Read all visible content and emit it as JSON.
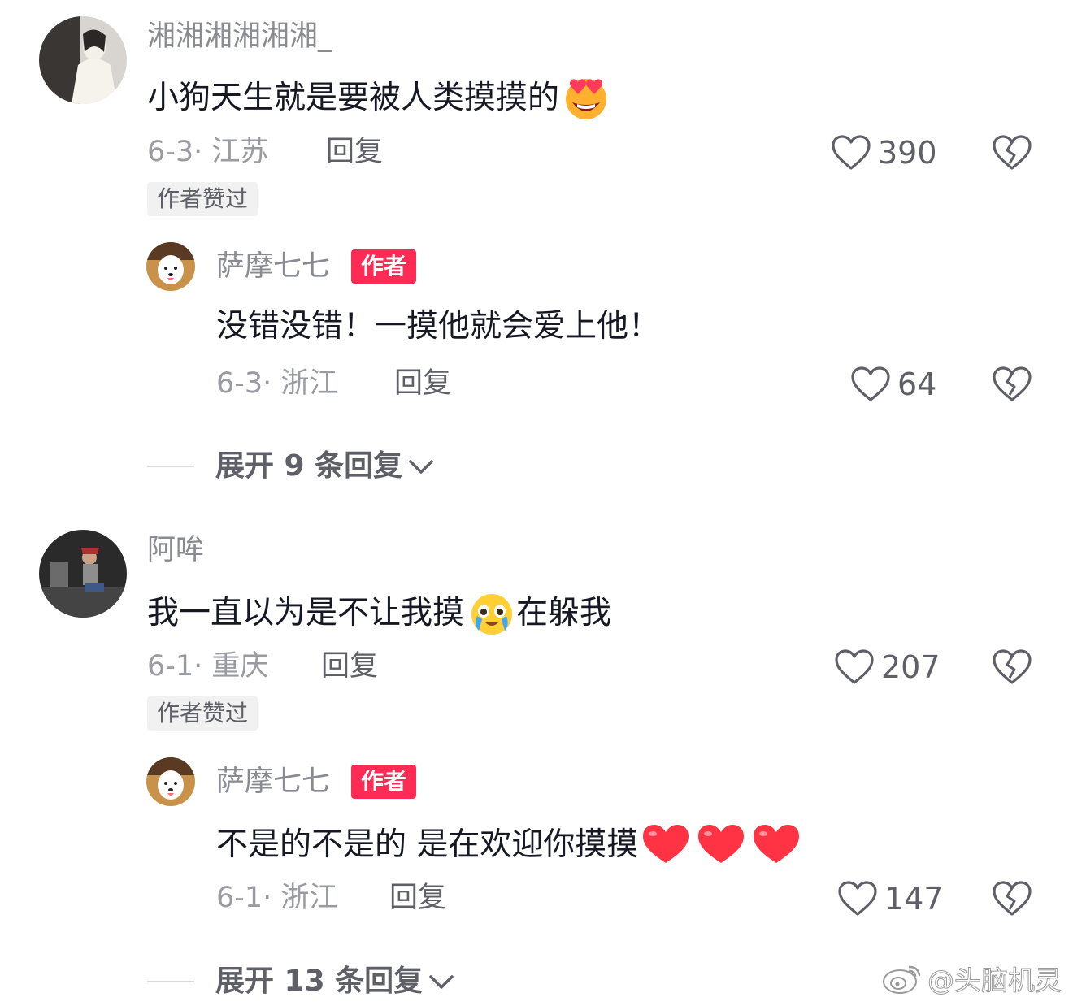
{
  "comments": [
    {
      "username": "湘湘湘湘湘湘_",
      "text": "小狗天生就是要被人类摸摸的",
      "date_location": "6-3· 江苏",
      "reply_label": "回复",
      "likes": "390",
      "badge": "作者赞过",
      "emoji": "heart-eyes-emoji",
      "replies": [
        {
          "username": "萨摩七七",
          "tag": "作者",
          "text": "没错没错！一摸他就会爱上他！",
          "date_location": "6-3· 浙江",
          "reply_label": "回复",
          "likes": "64"
        }
      ],
      "expand_label": "展开 9 条回复"
    },
    {
      "username": "阿哞",
      "text_before": "我一直以为是不让我摸",
      "text_after": "在躲我",
      "date_location": "6-1· 重庆",
      "reply_label": "回复",
      "likes": "207",
      "badge": "作者赞过",
      "emoji": "teary-face-emoji",
      "replies": [
        {
          "username": "萨摩七七",
          "tag": "作者",
          "text": "不是的不是的 是在欢迎你摸摸",
          "date_location": "6-1· 浙江",
          "reply_label": "回复",
          "likes": "147",
          "emoji": "red-heart-emoji"
        }
      ],
      "expand_label": "展开 13 条回复"
    }
  ],
  "watermark": "@头脑机灵",
  "colors": {
    "accent": "#fe2c55",
    "muted": "#9a9ba1",
    "text": "#161823"
  }
}
